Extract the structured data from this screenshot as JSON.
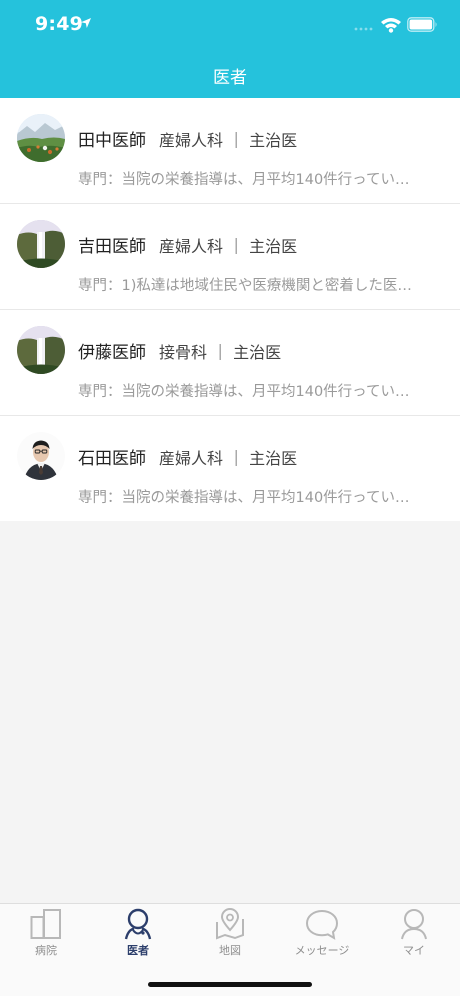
{
  "status_bar": {
    "time": "9:49"
  },
  "nav": {
    "title": "医者"
  },
  "doctors": [
    {
      "name": "田中医師",
      "dept": "産婦人科 ｜ 主治医",
      "specialty": "専門：当院の栄養指導は、月平均140件行ってい…",
      "avatar": "landscape-photo"
    },
    {
      "name": "吉田医師",
      "dept": "産婦人科 ｜ 主治医",
      "specialty": "専門：1)私達は地域住民や医療機関と密着した医…",
      "avatar": "waterfall-photo"
    },
    {
      "name": "伊藤医師",
      "dept": "接骨科 ｜ 主治医",
      "specialty": "専門：当院の栄養指導は、月平均140件行ってい…",
      "avatar": "waterfall-photo"
    },
    {
      "name": "石田医師",
      "dept": "産婦人科 ｜ 主治医",
      "specialty": "専門：当院の栄養指導は、月平均140件行ってい…",
      "avatar": "portrait-photo"
    }
  ],
  "tabs": [
    {
      "label": "病院",
      "icon": "hospital-icon",
      "active": false
    },
    {
      "label": "医者",
      "icon": "doctor-icon",
      "active": true
    },
    {
      "label": "地図",
      "icon": "map-icon",
      "active": false
    },
    {
      "label": "メッセージ",
      "icon": "message-icon",
      "active": false
    },
    {
      "label": "マイ",
      "icon": "profile-icon",
      "active": false
    }
  ],
  "colors": {
    "header": "#25c2dc",
    "active_tab": "#2c3e6b",
    "inactive_tab": "#b8b8b8"
  }
}
